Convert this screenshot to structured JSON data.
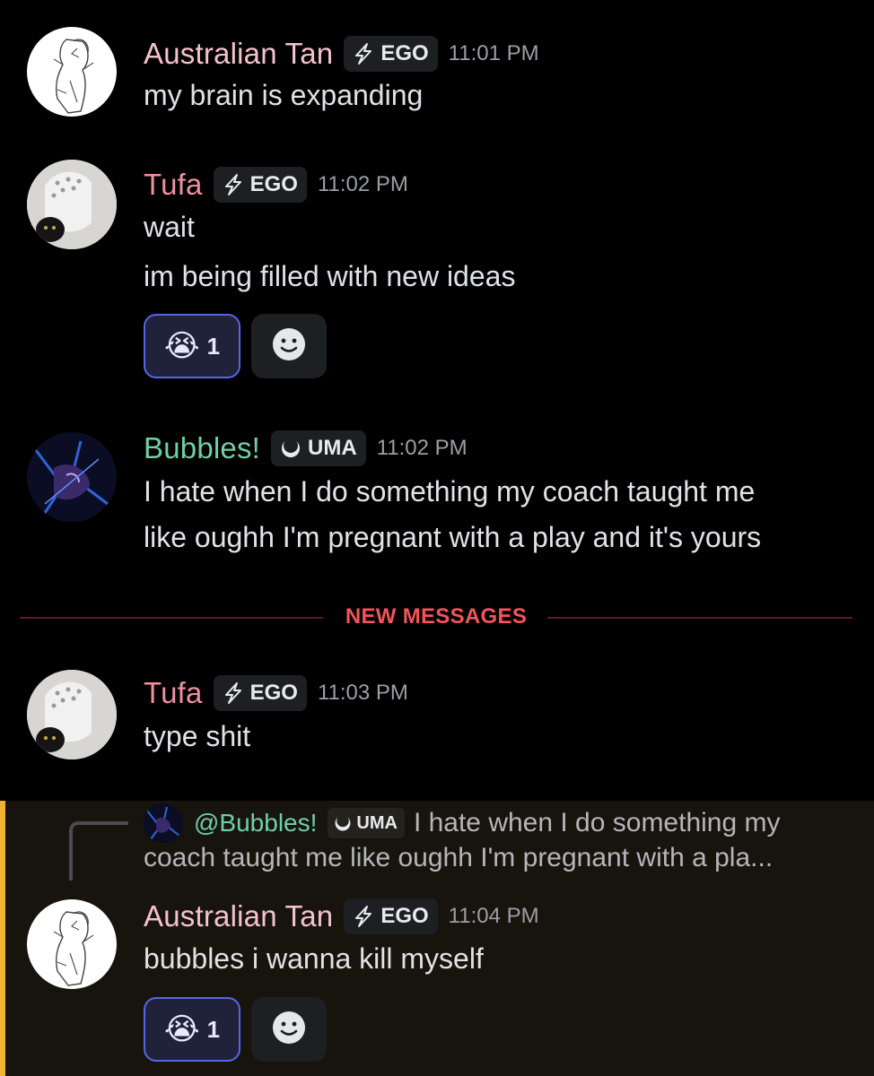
{
  "colors": {
    "tan_name": "#f4c1d0",
    "tufa_name": "#ef8fa0",
    "bubbles_name": "#6fcfa5",
    "new_messages": "#f2545b",
    "highlight_bar": "#f0b232",
    "reaction_border": "#5765e8"
  },
  "messages": [
    {
      "author": "Australian Tan",
      "tag": "EGO",
      "tag_icon": "lightning-icon",
      "time": "11:01 PM",
      "lines": [
        "my brain is expanding"
      ]
    },
    {
      "author": "Tufa",
      "tag": "EGO",
      "tag_icon": "lightning-icon",
      "time": "11:02 PM",
      "lines": [
        "wait",
        "im being filled with new ideas"
      ],
      "reaction": {
        "emoji": "😭",
        "count": "1"
      }
    },
    {
      "author": "Bubbles!",
      "tag": "UMA",
      "tag_icon": "crescent-icon",
      "time": "11:02 PM",
      "lines": [
        "I hate when I do something my coach taught me",
        "like oughh I'm pregnant with a play and it's yours"
      ]
    },
    {
      "author": "Tufa",
      "tag": "EGO",
      "tag_icon": "lightning-icon",
      "time": "11:03 PM",
      "lines": [
        "type shit"
      ]
    },
    {
      "author": "Australian Tan",
      "tag": "EGO",
      "tag_icon": "lightning-icon",
      "time": "11:04 PM",
      "lines": [
        "bubbles i wanna kill myself"
      ],
      "reaction": {
        "emoji": "😭",
        "count": "1"
      },
      "reply": {
        "mention": "@Bubbles!",
        "tag": "UMA",
        "line1": "I hate when I do something my",
        "line2": "coach taught me like oughh I'm pregnant with a pla..."
      }
    }
  ],
  "divider": {
    "label": "NEW MESSAGES"
  }
}
